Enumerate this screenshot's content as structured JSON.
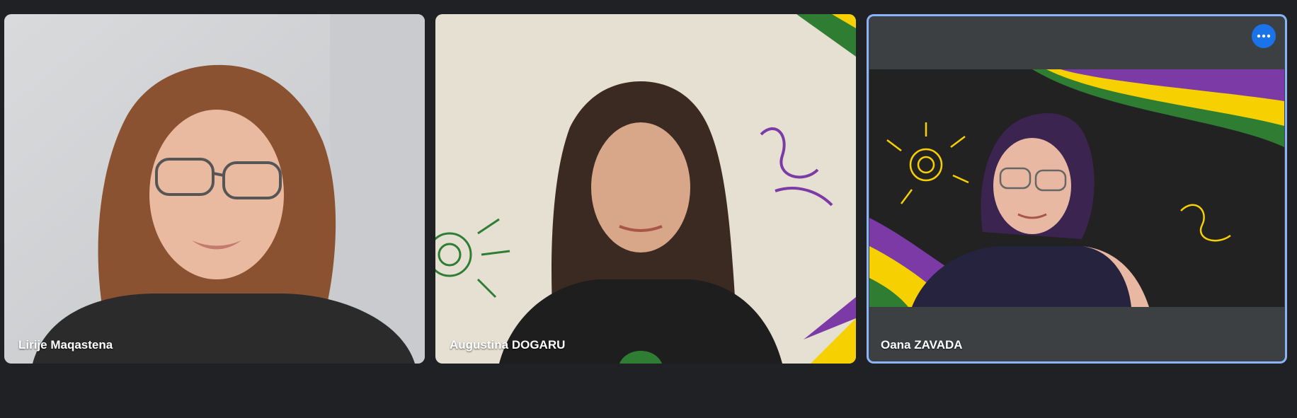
{
  "participants": [
    {
      "name": "Lirije Maqastena"
    },
    {
      "name": "Augustina DOGARU"
    },
    {
      "name": "Oana ZAVADA",
      "active": true
    }
  ],
  "colors": {
    "background": "#202124",
    "tile_background": "#3c4043",
    "active_border": "#8ab4f8",
    "more_button": "#1a73e8"
  },
  "icons": {
    "more_options": "more-horizontal-icon"
  }
}
